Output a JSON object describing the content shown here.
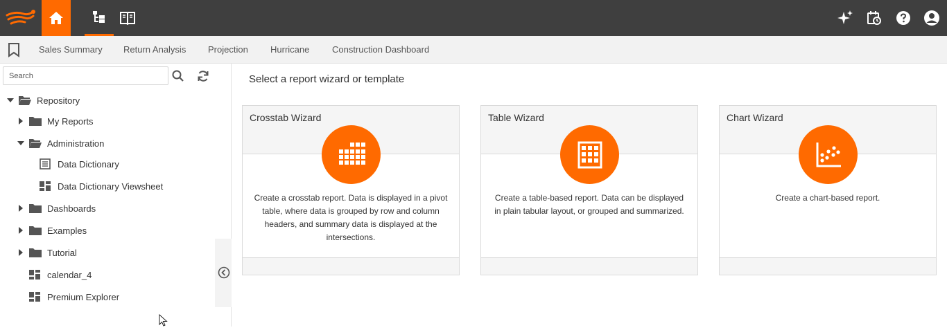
{
  "topbar": {
    "icons": [
      "logo-icon",
      "home-icon",
      "repository-tree-icon",
      "portal-book-icon",
      "ai-sparkle-icon",
      "schedule-icon",
      "help-icon",
      "account-icon"
    ],
    "accent": "#ff6a00",
    "background": "#3f3f3f"
  },
  "tabs": [
    "Sales Summary",
    "Return Analysis",
    "Projection",
    "Hurricane",
    "Construction Dashboard"
  ],
  "search": {
    "placeholder": "Search"
  },
  "tree": {
    "root": "Repository",
    "items": {
      "my_reports": "My Reports",
      "administration": "Administration",
      "data_dictionary": "Data Dictionary",
      "data_dictionary_viewsheet": "Data Dictionary Viewsheet",
      "dashboards": "Dashboards",
      "examples": "Examples",
      "tutorial": "Tutorial",
      "calendar_4": "calendar_4",
      "premium_explorer": "Premium Explorer"
    }
  },
  "main": {
    "title": "Select a report wizard or template",
    "cards": [
      {
        "title": "Crosstab Wizard",
        "icon": "grid-icon",
        "description": "Create a crosstab report. Data is displayed in a pivot table, where data is grouped by row and column headers, and summary data is displayed at the intersections."
      },
      {
        "title": "Table Wizard",
        "icon": "table-icon",
        "description": "Create a table-based report. Data can be displayed in plain tabular layout, or grouped and summarized."
      },
      {
        "title": "Chart Wizard",
        "icon": "scatter-chart-icon",
        "description": "Create a chart-based report."
      }
    ]
  }
}
